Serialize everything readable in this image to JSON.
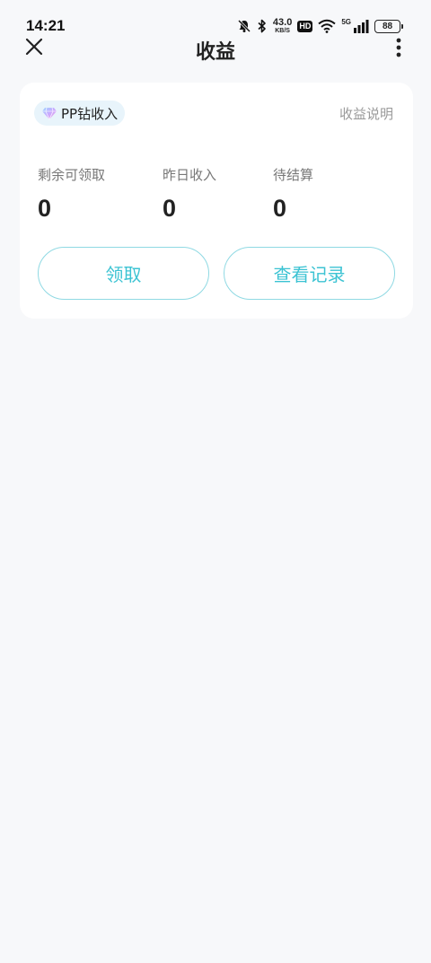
{
  "status_bar": {
    "time": "14:21",
    "net_speed_value": "43.0",
    "net_speed_unit": "KB/S",
    "hd": "HD",
    "network": "5G",
    "battery": "88"
  },
  "header": {
    "title": "收益"
  },
  "card": {
    "badge_label": "PP钻收入",
    "explain_link": "收益说明",
    "stats": [
      {
        "label": "剩余可领取",
        "value": "0"
      },
      {
        "label": "昨日收入",
        "value": "0"
      },
      {
        "label": "待结算",
        "value": "0"
      }
    ],
    "claim_button": "领取",
    "records_button": "查看记录"
  },
  "colors": {
    "accent": "#3cc3d3",
    "button_border": "#8fd9e3",
    "page_background": "#f7f8fa"
  }
}
